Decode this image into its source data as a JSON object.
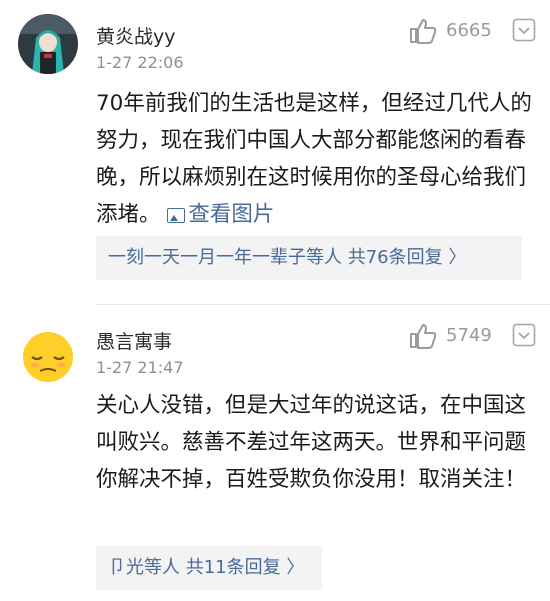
{
  "comments": [
    {
      "username": "黄炎战yy",
      "time": "1-27 22:06",
      "likes": "6665",
      "text": "70年前我们的生活也是这样，但经过几代人的努力，现在我们中国人大部分都能悠闲的看春晚，所以麻烦别在这时候用你的圣母心给我们添堵。",
      "view_picture": "查看图片",
      "reply_summary": "一刻一天一月一年一辈子等人  共76条回复 〉",
      "avatar_icon": "anime-character-avatar-icon"
    },
    {
      "username": "愚言寓事",
      "time": "1-27 21:47",
      "likes": "5749",
      "text": "关心人没错，但是大过年的说这话，在中国这叫败兴。慈善不差过年这两天。世界和平问题你解决不掉，百姓受欺负你没用！取消关注！",
      "reply_summary": "卩光等人  共11条回复 〉",
      "avatar_icon": "sleepy-emoji-avatar-icon"
    }
  ],
  "colors": {
    "link": "#486a99",
    "reply_bg": "#f3f3f3",
    "meta_gray": "#8f8f8f"
  }
}
